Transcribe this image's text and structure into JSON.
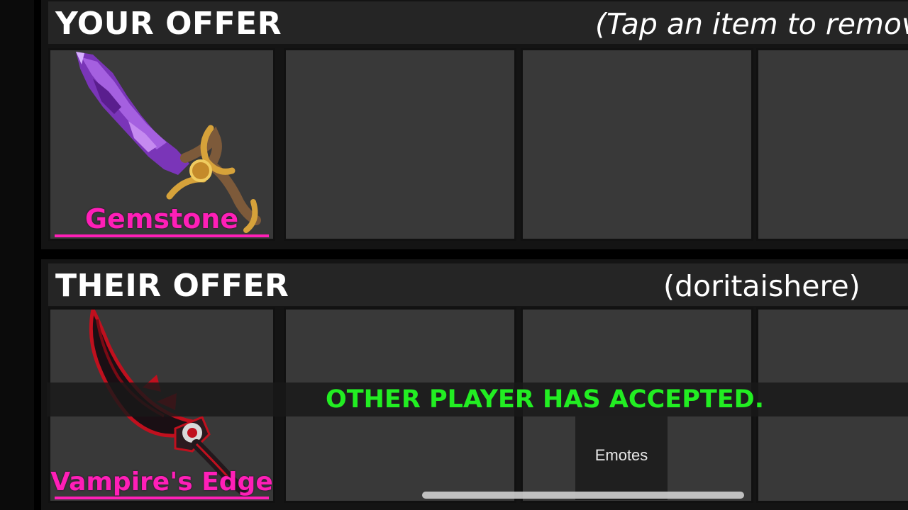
{
  "your_offer": {
    "title": "YOUR OFFER",
    "hint": "(Tap an item to remove)",
    "slots": [
      {
        "item_name": "Gemstone",
        "icon": "gemstone-knife-icon"
      },
      {
        "item_name": null
      },
      {
        "item_name": null
      },
      {
        "item_name": null
      }
    ]
  },
  "their_offer": {
    "title": "THEIR OFFER",
    "player": "(doritaishere)",
    "slots": [
      {
        "item_name": "Vampire's Edge",
        "icon": "vampires-edge-knife-icon"
      },
      {
        "item_name": null
      },
      {
        "item_name": null
      },
      {
        "item_name": null
      }
    ]
  },
  "status_banner": "OTHER PLAYER HAS ACCEPTED.",
  "emotes_button": "Emotes",
  "colors": {
    "item_name": "#ff1fb7",
    "accepted": "#22ee22",
    "slot_bg": "#393939",
    "header_bg": "#252525"
  }
}
